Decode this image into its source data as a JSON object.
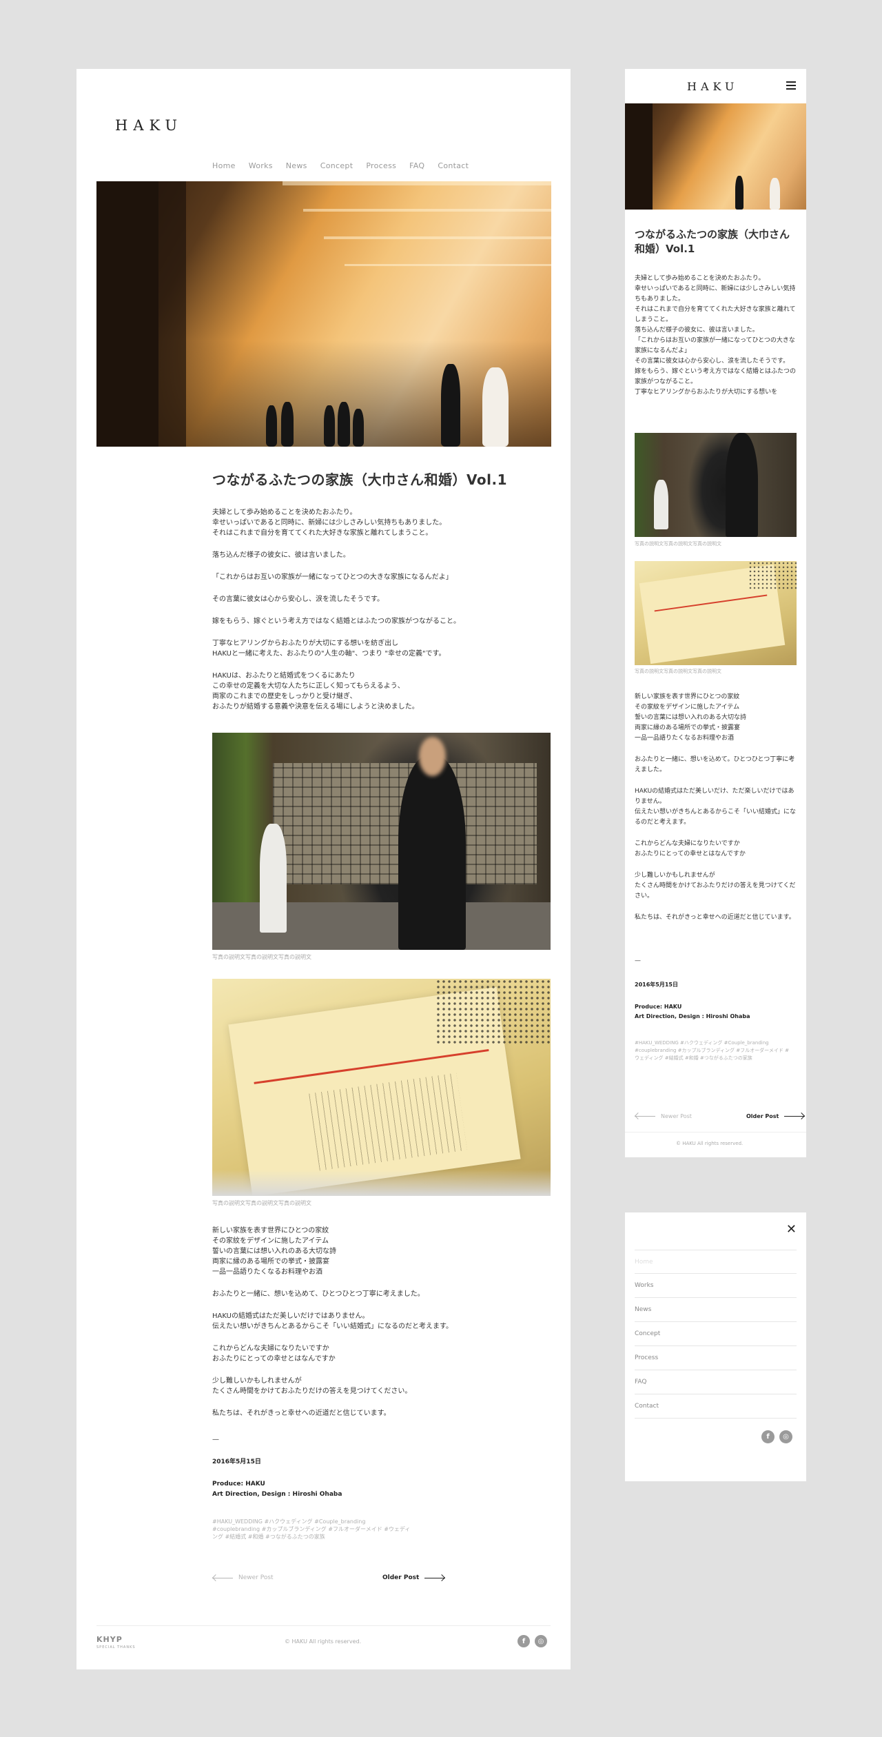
{
  "brand": "HAKU",
  "nav": [
    "Home",
    "Works",
    "News",
    "Concept",
    "Process",
    "FAQ",
    "Contact"
  ],
  "post": {
    "title": "つながるふたつの家族（大巾さん和婚）Vol.1",
    "paragraphs_1": [
      "夫婦として歩み始めることを決めたおふたり。\n幸せいっぱいであると同時に、新婦には少しさみしい気持ちもありました。\nそれはこれまで自分を育ててくれた大好きな家族と離れてしまうこと。",
      "落ち込んだ様子の彼女に、彼は言いました。",
      "「これからはお互いの家族が一緒になってひとつの大きな家族になるんだよ」",
      "その言葉に彼女は心から安心し、涙を流したそうです。",
      "嫁をもらう、嫁ぐという考え方ではなく結婚とはふたつの家族がつながること。",
      "丁寧なヒアリングからおふたりが大切にする想いを紡ぎ出し\nHAKUと一緒に考えた、おふたりの\"人生の軸\"、つまり \"幸せの定義\"です。",
      "HAKUは、おふたりと結婚式をつくるにあたり\nこの幸せの定義を大切な人たちに正しく知ってもらえるよう、\n両家のこれまでの歴史をしっかりと受け継ぎ、\nおふたりが結婚する意義や決意を伝える場にしようと決めました。"
    ],
    "caption_1": "写真の説明文写真の説明文写真の説明文",
    "caption_2": "写真の説明文写真の説明文写真の説明文",
    "paragraphs_2": [
      "新しい家族を表す世界にひとつの家紋\nその家紋をデザインに施したアイテム\n誓いの言葉には想い入れのある大切な詩\n両家に縁のある場所での挙式・披露宴\n一品一品語りたくなるお料理やお酒",
      "おふたりと一緒に、想いを込めて、ひとつひとつ丁寧に考えました。",
      "HAKUの結婚式はただ美しいだけではありません。\n伝えたい想いがきちんとあるからこそ「いい結婚式」になるのだと考えます。",
      "これからどんな夫婦になりたいですか\nおふたりにとっての幸せとはなんですか",
      "少し難しいかもしれませんが\nたくさん時間をかけておふたりだけの答えを見つけてください。",
      "私たちは、それがきっと幸せへの近道だと信じています。"
    ],
    "separator": "—",
    "date": "2016年5月15日",
    "produce": "Produce: HAKU",
    "credits": "Art Direction, Design : Hiroshi Ohaba",
    "tags": "#HAKU_WEDDING #ハクウェディング #Couple_branding #couplebranding #カップルブランディング #フルオーダーメイド #ウェディング #結婚式 #和婚 #つながるふたつの家族"
  },
  "mobile": {
    "paragraphs_1": "夫婦として歩み始めることを決めたおふたり。\n幸せいっぱいであると同時に、新婦には少しさみしい気持ちもありました。\nそれはこれまで自分を育ててくれた大好きな家族と離れてしまうこと。\n落ち込んだ様子の彼女に、彼は言いました。\n「これからはお互いの家族が一緒になってひとつの大きな家族になるんだよ」\nその言葉に彼女は心から安心し、涙を流したそうです。\n嫁をもらう、嫁ぐという考え方ではなく結婚とはふたつの家族がつながること。\n丁寧なヒアリングからおふたりが大切にする想いを",
    "paragraphs_2": [
      "新しい家族を表す世界にひとつの家紋\nその家紋をデザインに施したアイテム\n誓いの言葉には想い入れのある大切な詩\n両家に縁のある場所での挙式・披露宴\n一品一品語りたくなるお料理やお酒",
      "おふたりと一緒に、想いを込めて。ひとつひとつ丁寧に考えました。",
      "HAKUの結婚式はただ美しいだけ、ただ楽しいだけではありません。\n伝えたい想いがきちんとあるからこそ「いい結婚式」になるのだと考えます。",
      "これからどんな夫婦になりたいですか\nおふたりにとっての幸せとはなんですか",
      "少し難しいかもしれませんが\nたくさん時間をかけておふたりだけの答えを見つけてください。",
      "私たちは、それがきっと幸せへの近道だと信じています。"
    ]
  },
  "pager": {
    "newer": "Newer Post",
    "older": "Older Post"
  },
  "footer": {
    "logo": "KHYP",
    "logo_sub": "SPECIAL THANKS",
    "copyright": "© HAKU All rights reserved.",
    "social": [
      {
        "icon": "facebook-icon",
        "glyph": "f"
      },
      {
        "icon": "instagram-icon",
        "glyph": "◎"
      }
    ]
  },
  "menu": {
    "close": "✕"
  },
  "colors": {
    "background": "#e1e1e1",
    "panel": "#ffffff",
    "muted": "#9a9a9a"
  }
}
